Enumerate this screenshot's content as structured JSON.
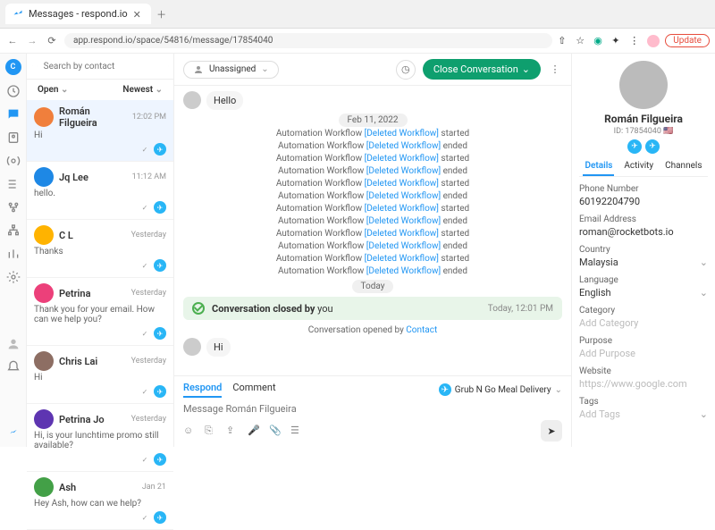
{
  "browser": {
    "tab_title": "Messages - respond.io",
    "url": "app.respond.io/space/54816/message/17854040",
    "update_btn": "Update"
  },
  "search": {
    "placeholder": "Search by contact"
  },
  "filters": {
    "open": "Open",
    "sort": "Newest"
  },
  "conversations": [
    {
      "name": "Román Filgueira",
      "time": "12:02 PM",
      "preview": "Hi",
      "active": true,
      "avatar": "#f07f3c"
    },
    {
      "name": "Jq Lee",
      "time": "11:12 AM",
      "preview": "hello.",
      "avatar": "#1e88e5"
    },
    {
      "name": "C L",
      "time": "Yesterday",
      "preview": "Thanks",
      "avatar": "#ffb300"
    },
    {
      "name": "Petrina",
      "time": "Yesterday",
      "preview": "Thank you for your email. How can we help you?",
      "avatar": "#ec407a"
    },
    {
      "name": "Chris Lai",
      "time": "Yesterday",
      "preview": "Hi",
      "avatar": "#8d6e63"
    },
    {
      "name": "Petrina Jo",
      "time": "Yesterday",
      "preview": "Hi, is your lunchtime promo still available?",
      "avatar": "#5e35b1"
    },
    {
      "name": "Ash",
      "time": "Jan 21",
      "preview": "Hey Ash, how can we help?",
      "avatar": "#43a047"
    }
  ],
  "chat": {
    "assignee_label": "Unassigned",
    "close_btn": "Close Conversation",
    "hello_msg": "Hello",
    "date1": "Feb 11, 2022",
    "events": [
      {
        "suffix": "started"
      },
      {
        "suffix": "ended"
      },
      {
        "suffix": "started"
      },
      {
        "suffix": "ended"
      },
      {
        "suffix": "started"
      },
      {
        "suffix": "ended"
      },
      {
        "suffix": "started"
      },
      {
        "suffix": "ended"
      },
      {
        "suffix": "started"
      },
      {
        "suffix": "ended"
      },
      {
        "suffix": "started"
      },
      {
        "suffix": "ended"
      }
    ],
    "event_prefix": "Automation Workflow ",
    "event_link": "[Deleted Workflow]",
    "today": "Today",
    "closed_pre": "Conversation closed by ",
    "closed_by": "you",
    "closed_time": "Today, 12:01 PM",
    "opened_pre": "Conversation opened by ",
    "opened_by": "Contact",
    "hi_msg": "Hi"
  },
  "composer": {
    "tab_respond": "Respond",
    "tab_comment": "Comment",
    "channel": "Grub N Go Meal Delivery",
    "placeholder": "Message Román Filgueira"
  },
  "profile": {
    "name": "Román Filgueira",
    "id": "ID: 17854040",
    "tabs": {
      "details": "Details",
      "activity": "Activity",
      "channels": "Channels"
    },
    "fields": {
      "phone_label": "Phone Number",
      "phone_value": "60192204790",
      "email_label": "Email Address",
      "email_value": "roman@rocketbots.io",
      "country_label": "Country",
      "country_value": "Malaysia",
      "language_label": "Language",
      "language_value": "English",
      "category_label": "Category",
      "category_ph": "Add Category",
      "purpose_label": "Purpose",
      "purpose_ph": "Add Purpose",
      "website_label": "Website",
      "website_ph": "https://www.google.com",
      "tags_label": "Tags",
      "tags_ph": "Add Tags"
    }
  }
}
